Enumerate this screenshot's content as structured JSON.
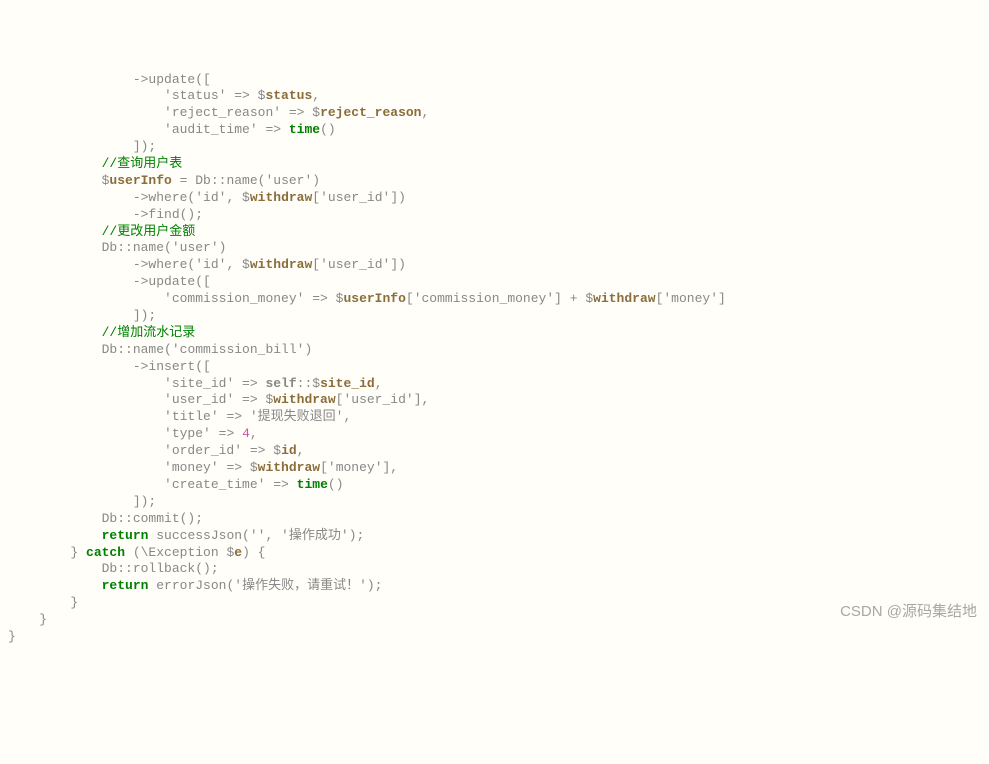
{
  "watermark": "CSDN @源码集结地",
  "code": {
    "l01": "                ->update([",
    "l02a": "                    '",
    "l02b": "status",
    "l02c": "' => $",
    "l02d": "status",
    "l02e": ",",
    "l03a": "                    '",
    "l03b": "reject_reason",
    "l03c": "' => $",
    "l03d": "reject_reason",
    "l03e": ",",
    "l04a": "                    '",
    "l04b": "audit_time",
    "l04c": "' => ",
    "l04d": "time",
    "l04e": "()",
    "l05": "                ]);",
    "l06a": "            //",
    "l06b": "查询用户表",
    "l07a": "            $",
    "l07b": "userInfo",
    "l07c": " = Db::name('",
    "l07d": "user",
    "l07e": "')",
    "l08a": "                ->where('",
    "l08b": "id",
    "l08c": "', $",
    "l08d": "withdraw",
    "l08e": "['",
    "l08f": "user_id",
    "l08g": "'])",
    "l09": "                ->find();",
    "l10a": "            //",
    "l10b": "更改用户金额",
    "l11a": "            Db::name('",
    "l11b": "user",
    "l11c": "')",
    "l12a": "                ->where('",
    "l12b": "id",
    "l12c": "', $",
    "l12d": "withdraw",
    "l12e": "['",
    "l12f": "user_id",
    "l12g": "'])",
    "l13": "                ->update([",
    "l14a": "                    '",
    "l14b": "commission_money",
    "l14c": "' => $",
    "l14d": "userInfo",
    "l14e": "['",
    "l14f": "commission_money",
    "l14g": "'] + $",
    "l14h": "withdraw",
    "l14i": "['",
    "l14j": "money",
    "l14k": "']",
    "l15": "                ]);",
    "l16a": "            //",
    "l16b": "增加流水记录",
    "l17a": "            Db::name('",
    "l17b": "commission_bill",
    "l17c": "')",
    "l18": "                ->insert([",
    "l19a": "                    '",
    "l19b": "site_id",
    "l19c": "' => ",
    "l19d": "self",
    "l19e": "::$",
    "l19f": "site_id",
    "l19g": ",",
    "l20a": "                    '",
    "l20b": "user_id",
    "l20c": "' => $",
    "l20d": "withdraw",
    "l20e": "['",
    "l20f": "user_id",
    "l20g": "'],",
    "l21a": "                    '",
    "l21b": "title",
    "l21c": "' => '",
    "l21d": "提现失败退回",
    "l21e": "',",
    "l22a": "                    '",
    "l22b": "type",
    "l22c": "' => ",
    "l22d": "4",
    "l22e": ",",
    "l23a": "                    '",
    "l23b": "order_id",
    "l23c": "' => $",
    "l23d": "id",
    "l23e": ",",
    "l24a": "                    '",
    "l24b": "money",
    "l24c": "' => $",
    "l24d": "withdraw",
    "l24e": "['",
    "l24f": "money",
    "l24g": "'],",
    "l25a": "                    '",
    "l25b": "create_time",
    "l25c": "' => ",
    "l25d": "time",
    "l25e": "()",
    "l26": "                ]);",
    "l27": "",
    "l28": "            Db::commit();",
    "l29a": "            ",
    "l29b": "return",
    "l29c": " successJson('', '",
    "l29d": "操作成功",
    "l29e": "');",
    "l30a": "        } ",
    "l30b": "catch",
    "l30c": " (\\Exception $",
    "l30d": "e",
    "l30e": ") {",
    "l31": "            Db::rollback();",
    "l32a": "            ",
    "l32b": "return",
    "l32c": " errorJson('",
    "l32d": "操作失败，请重试！",
    "l32e": "');",
    "l33": "        }",
    "l34": "",
    "l35": "    }",
    "l36": "}"
  }
}
